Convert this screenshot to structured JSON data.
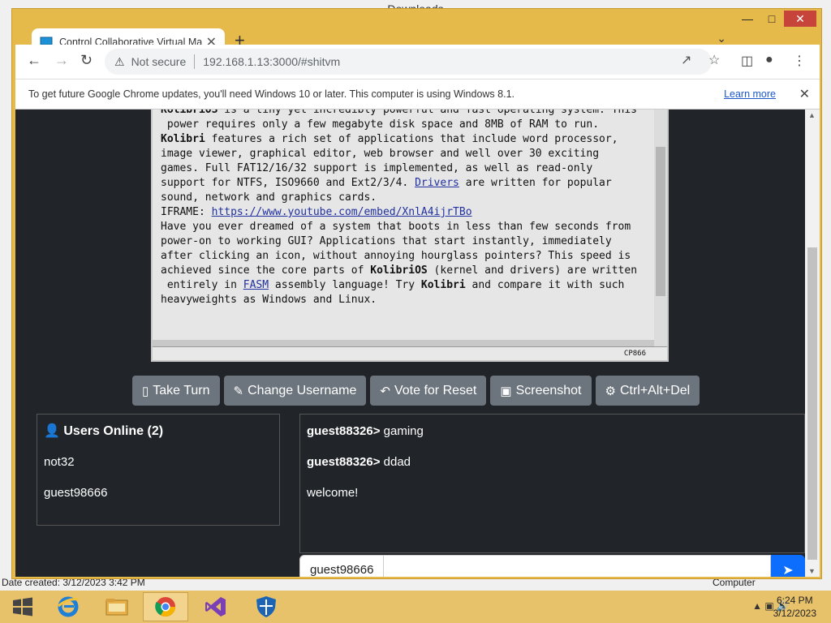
{
  "desktop": {
    "bg_title": "Downloads",
    "status_left": "Date created: 3/12/2023 3:42 PM",
    "status_right": "Computer"
  },
  "browser": {
    "tab_title": "Control Collaborative Virtual Ma",
    "url_warning": "Not secure",
    "url": "192.168.1.13:3000/#shitvm",
    "infobar_text": "To get future Google Chrome updates, you'll need Windows 10 or later. This computer is using Windows 8.1.",
    "infobar_link": "Learn more"
  },
  "vm": {
    "lines": [
      "KolibriOS is a tiny yet incredibly powerful and fast operating system. This",
      " power requires only a few megabyte disk space and 8MB of RAM to run.",
      "Kolibri features a rich set of applications that include word processor,",
      "image viewer, graphical editor, web browser and well over 30 exciting",
      "games. Full FAT12/16/32 support is implemented, as well as read-only",
      "support for NTFS, ISO9660 and Ext2/3/4. Drivers are written for popular",
      "sound, network and graphics cards.",
      "",
      "IFRAME: https://www.youtube.com/embed/XnlA4ijrTBo",
      "",
      "Have you ever dreamed of a system that boots in less than few seconds from",
      "power-on to working GUI? Applications that start instantly, immediately",
      "after clicking an icon, without annoying hourglass pointers? This speed is",
      "achieved since the core parts of KolibriOS (kernel and drivers) are written",
      " entirely in FASM assembly language! Try Kolibri and compare it with such",
      "heavyweights as Windows and Linux."
    ],
    "status": "CP866"
  },
  "actions": {
    "take_turn": "Take Turn",
    "change_username": "Change Username",
    "vote_reset": "Vote for Reset",
    "screenshot": "Screenshot",
    "ctrl_alt_del": "Ctrl+Alt+Del"
  },
  "users": {
    "heading": "Users Online (2)",
    "list": [
      "not32",
      "guest98666"
    ]
  },
  "chat": {
    "messages": [
      {
        "user": "guest88326>",
        "text": " gaming"
      },
      {
        "user": "guest88326>",
        "text": " ddad"
      },
      {
        "user": "",
        "text": "welcome!"
      }
    ],
    "input_name": "guest98666",
    "input_placeholder": ""
  },
  "taskbar": {
    "time": "6:24 PM",
    "date": "3/12/2023"
  },
  "colors": {
    "page_bg": "#212529",
    "button_bg": "#6c757d",
    "send_bg": "#0d6efd",
    "chrome_frame": "#e5b94a"
  }
}
